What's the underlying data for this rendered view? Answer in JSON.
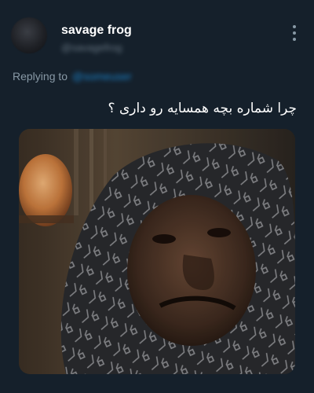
{
  "author": {
    "display_name": "savage frog",
    "handle": "@savagefrog"
  },
  "reply": {
    "prefix": "Replying to",
    "handle": "@someuser"
  },
  "tweet": {
    "text": "چرا شماره بچه همسایه رو داری ؟"
  },
  "icons": {
    "more": "more-vertical-icon"
  },
  "colors": {
    "background": "#15202b",
    "secondary_text": "#8899a6",
    "link": "#1d9bf0"
  }
}
